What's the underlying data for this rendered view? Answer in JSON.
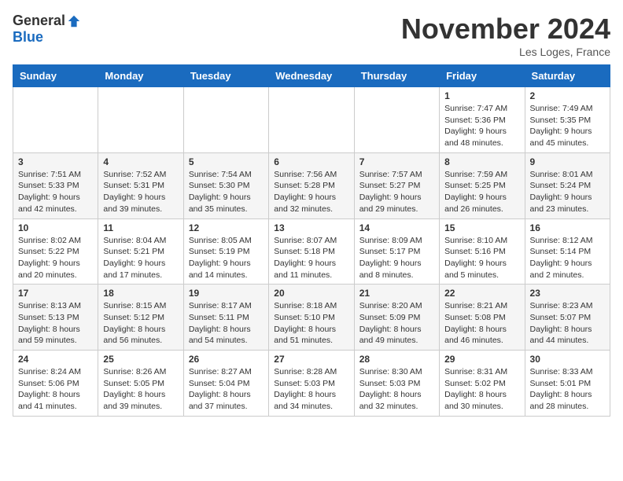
{
  "header": {
    "logo_general": "General",
    "logo_blue": "Blue",
    "title": "November 2024",
    "subtitle": "Les Loges, France"
  },
  "weekdays": [
    "Sunday",
    "Monday",
    "Tuesday",
    "Wednesday",
    "Thursday",
    "Friday",
    "Saturday"
  ],
  "weeks": [
    [
      {
        "day": "",
        "info": ""
      },
      {
        "day": "",
        "info": ""
      },
      {
        "day": "",
        "info": ""
      },
      {
        "day": "",
        "info": ""
      },
      {
        "day": "",
        "info": ""
      },
      {
        "day": "1",
        "info": "Sunrise: 7:47 AM\nSunset: 5:36 PM\nDaylight: 9 hours and 48 minutes."
      },
      {
        "day": "2",
        "info": "Sunrise: 7:49 AM\nSunset: 5:35 PM\nDaylight: 9 hours and 45 minutes."
      }
    ],
    [
      {
        "day": "3",
        "info": "Sunrise: 7:51 AM\nSunset: 5:33 PM\nDaylight: 9 hours and 42 minutes."
      },
      {
        "day": "4",
        "info": "Sunrise: 7:52 AM\nSunset: 5:31 PM\nDaylight: 9 hours and 39 minutes."
      },
      {
        "day": "5",
        "info": "Sunrise: 7:54 AM\nSunset: 5:30 PM\nDaylight: 9 hours and 35 minutes."
      },
      {
        "day": "6",
        "info": "Sunrise: 7:56 AM\nSunset: 5:28 PM\nDaylight: 9 hours and 32 minutes."
      },
      {
        "day": "7",
        "info": "Sunrise: 7:57 AM\nSunset: 5:27 PM\nDaylight: 9 hours and 29 minutes."
      },
      {
        "day": "8",
        "info": "Sunrise: 7:59 AM\nSunset: 5:25 PM\nDaylight: 9 hours and 26 minutes."
      },
      {
        "day": "9",
        "info": "Sunrise: 8:01 AM\nSunset: 5:24 PM\nDaylight: 9 hours and 23 minutes."
      }
    ],
    [
      {
        "day": "10",
        "info": "Sunrise: 8:02 AM\nSunset: 5:22 PM\nDaylight: 9 hours and 20 minutes."
      },
      {
        "day": "11",
        "info": "Sunrise: 8:04 AM\nSunset: 5:21 PM\nDaylight: 9 hours and 17 minutes."
      },
      {
        "day": "12",
        "info": "Sunrise: 8:05 AM\nSunset: 5:19 PM\nDaylight: 9 hours and 14 minutes."
      },
      {
        "day": "13",
        "info": "Sunrise: 8:07 AM\nSunset: 5:18 PM\nDaylight: 9 hours and 11 minutes."
      },
      {
        "day": "14",
        "info": "Sunrise: 8:09 AM\nSunset: 5:17 PM\nDaylight: 9 hours and 8 minutes."
      },
      {
        "day": "15",
        "info": "Sunrise: 8:10 AM\nSunset: 5:16 PM\nDaylight: 9 hours and 5 minutes."
      },
      {
        "day": "16",
        "info": "Sunrise: 8:12 AM\nSunset: 5:14 PM\nDaylight: 9 hours and 2 minutes."
      }
    ],
    [
      {
        "day": "17",
        "info": "Sunrise: 8:13 AM\nSunset: 5:13 PM\nDaylight: 8 hours and 59 minutes."
      },
      {
        "day": "18",
        "info": "Sunrise: 8:15 AM\nSunset: 5:12 PM\nDaylight: 8 hours and 56 minutes."
      },
      {
        "day": "19",
        "info": "Sunrise: 8:17 AM\nSunset: 5:11 PM\nDaylight: 8 hours and 54 minutes."
      },
      {
        "day": "20",
        "info": "Sunrise: 8:18 AM\nSunset: 5:10 PM\nDaylight: 8 hours and 51 minutes."
      },
      {
        "day": "21",
        "info": "Sunrise: 8:20 AM\nSunset: 5:09 PM\nDaylight: 8 hours and 49 minutes."
      },
      {
        "day": "22",
        "info": "Sunrise: 8:21 AM\nSunset: 5:08 PM\nDaylight: 8 hours and 46 minutes."
      },
      {
        "day": "23",
        "info": "Sunrise: 8:23 AM\nSunset: 5:07 PM\nDaylight: 8 hours and 44 minutes."
      }
    ],
    [
      {
        "day": "24",
        "info": "Sunrise: 8:24 AM\nSunset: 5:06 PM\nDaylight: 8 hours and 41 minutes."
      },
      {
        "day": "25",
        "info": "Sunrise: 8:26 AM\nSunset: 5:05 PM\nDaylight: 8 hours and 39 minutes."
      },
      {
        "day": "26",
        "info": "Sunrise: 8:27 AM\nSunset: 5:04 PM\nDaylight: 8 hours and 37 minutes."
      },
      {
        "day": "27",
        "info": "Sunrise: 8:28 AM\nSunset: 5:03 PM\nDaylight: 8 hours and 34 minutes."
      },
      {
        "day": "28",
        "info": "Sunrise: 8:30 AM\nSunset: 5:03 PM\nDaylight: 8 hours and 32 minutes."
      },
      {
        "day": "29",
        "info": "Sunrise: 8:31 AM\nSunset: 5:02 PM\nDaylight: 8 hours and 30 minutes."
      },
      {
        "day": "30",
        "info": "Sunrise: 8:33 AM\nSunset: 5:01 PM\nDaylight: 8 hours and 28 minutes."
      }
    ]
  ]
}
